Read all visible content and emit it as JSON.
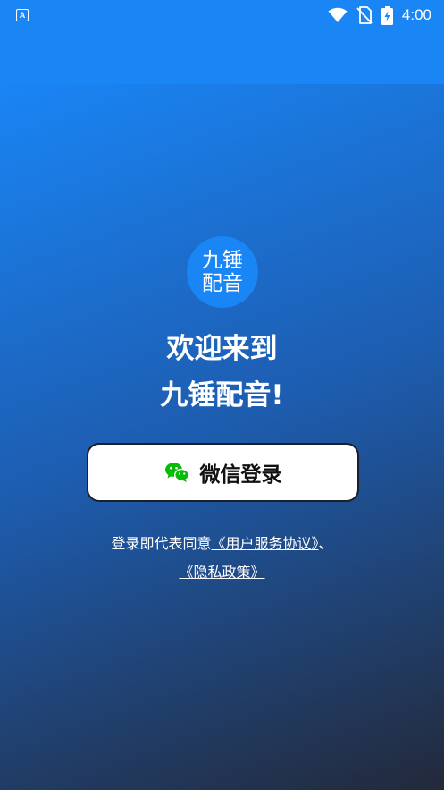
{
  "status_bar": {
    "app_icon_letter": "A",
    "time": "4:00"
  },
  "logo": {
    "line1": "九锤",
    "line2": "配音"
  },
  "welcome": {
    "line1": "欢迎来到",
    "line2": "九锤配音!"
  },
  "login": {
    "wechat_label": "微信登录"
  },
  "agreement": {
    "prefix": "登录即代表同意",
    "terms_link": "《用户服务协议》",
    "separator": "、",
    "privacy_link": "《隐私政策》"
  },
  "colors": {
    "brand_blue": "#1a85f5",
    "wechat_green": "#09bb07"
  }
}
